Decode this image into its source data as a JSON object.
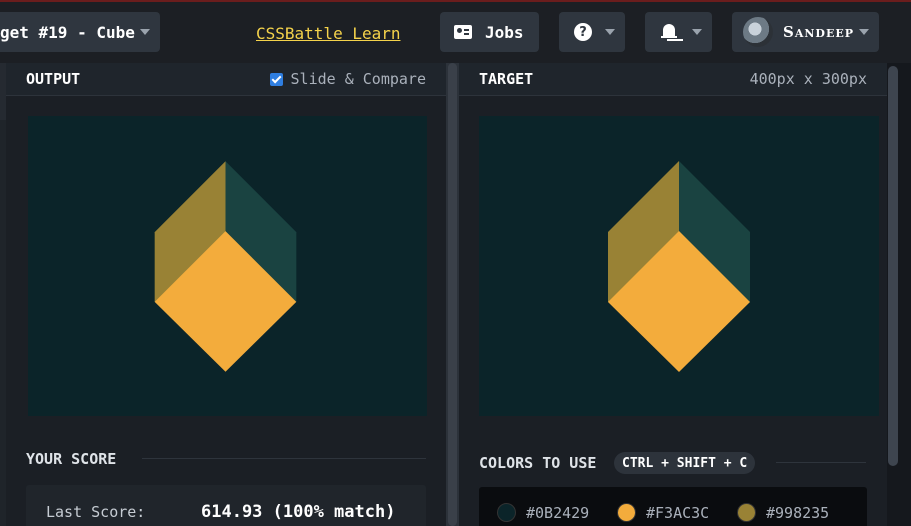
{
  "header": {
    "target_title": "get #19 - Cube",
    "learn_link": "CSSBattle Learn",
    "jobs_label": "Jobs",
    "help_glyph": "?",
    "user_name": "Sandeep",
    "icons": [
      "chevron-down-icon",
      "briefcase-icon",
      "help-icon",
      "bell-icon",
      "avatar"
    ]
  },
  "output_panel": {
    "title": "OUTPUT",
    "compare_label": "Slide & Compare",
    "compare_checked": true
  },
  "target_panel": {
    "title": "TARGET",
    "dimensions": "400px x 300px"
  },
  "score": {
    "title": "YOUR SCORE",
    "last_score_label": "Last Score:",
    "last_score_value": "614.93 (100% match)"
  },
  "colors": {
    "title": "COLORS TO USE",
    "shortcut": "CTRL + SHIFT + C",
    "items": [
      {
        "hex": "#0B2429",
        "label": "#0B2429"
      },
      {
        "hex": "#F3AC3C",
        "label": "#F3AC3C"
      },
      {
        "hex": "#998235",
        "label": "#998235"
      }
    ]
  },
  "theme": {
    "accent_link": "#f5d34b",
    "checkbox": "#2f7ee0",
    "cube_top": "#F3AC3C",
    "cube_left": "#998235",
    "cube_right": "#1A4341",
    "canvas_bg": "#0B2429"
  }
}
